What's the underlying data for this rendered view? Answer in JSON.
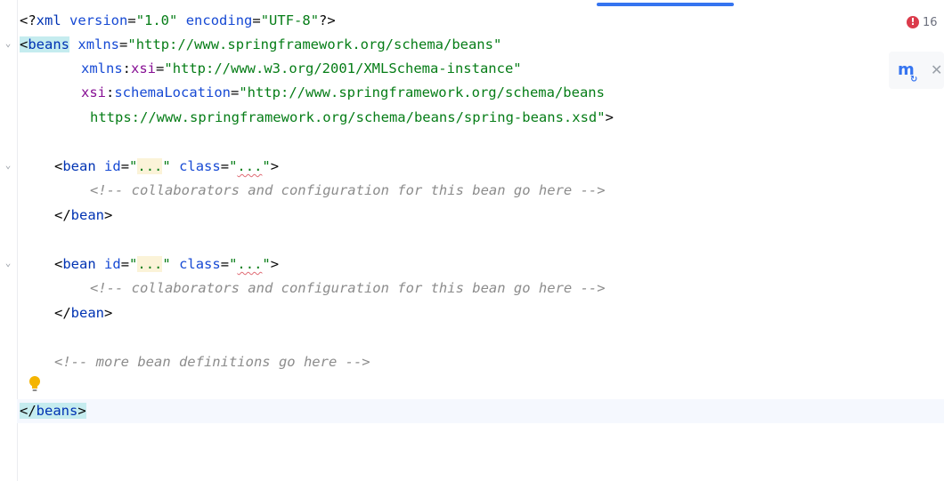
{
  "editor": {
    "lines": {
      "l1": {
        "open": "<?",
        "name": "xml",
        "a1": "version",
        "eq": "=",
        "v1": "\"1.0\"",
        "a2": "encoding",
        "v2": "\"UTF-8\"",
        "close": "?>"
      },
      "l2": {
        "lt": "<",
        "tag": "beans",
        "attr": "xmlns",
        "eq": "=",
        "val": "\"http://www.springframework.org/schema/beans\""
      },
      "l3": {
        "ns": "xmlns",
        "colon": ":",
        "attr": "xsi",
        "eq": "=",
        "val": "\"http://www.w3.org/2001/XMLSchema-instance\""
      },
      "l4": {
        "ns": "xsi",
        "colon": ":",
        "attr": "schemaLocation",
        "eq": "=",
        "val": "\"http://www.springframework.org/schema/beans"
      },
      "l5": {
        "val": "https://www.springframework.org/schema/beans/spring-beans.xsd\"",
        "gt": ">"
      },
      "bean1": {
        "lt": "<",
        "tag": "bean",
        "a1": "id",
        "eq": "=",
        "q": "\"",
        "v1": "...",
        "a2": "class",
        "v2": "...",
        "gt": ">",
        "comment": "<!-- collaborators and configuration for this bean go here -->",
        "close_lt": "</",
        "close_tag": "bean",
        "close_gt": ">"
      },
      "bean2": {
        "lt": "<",
        "tag": "bean",
        "a1": "id",
        "eq": "=",
        "q": "\"",
        "v1": "...",
        "a2": "class",
        "v2": "...",
        "gt": ">",
        "comment": "<!-- collaborators and configuration for this bean go here -->",
        "close_lt": "</",
        "close_tag": "bean",
        "close_gt": ">"
      },
      "more_comment": "<!-- more bean definitions go here -->",
      "end": {
        "lt": "</",
        "tag": "beans",
        "gt": ">"
      }
    }
  },
  "gutter": {
    "fold_glyph": "⌄"
  },
  "inspections": {
    "error_glyph": "!",
    "error_count": "16"
  },
  "floating_toolbar": {
    "maven_glyph": "m",
    "reload_glyph": "↻",
    "close_glyph": "✕"
  },
  "icons": {
    "intention": "lightbulb-icon",
    "maven": "maven-reload-icon",
    "close": "close-icon",
    "fold": "chevron-down-icon",
    "error": "error-icon"
  },
  "colors": {
    "tag": "#0033b3",
    "attribute": "#174ad4",
    "namespace": "#871094",
    "value": "#067d17",
    "comment": "#8c8c8c",
    "error": "#db3b4b",
    "accent": "#3574f0"
  }
}
